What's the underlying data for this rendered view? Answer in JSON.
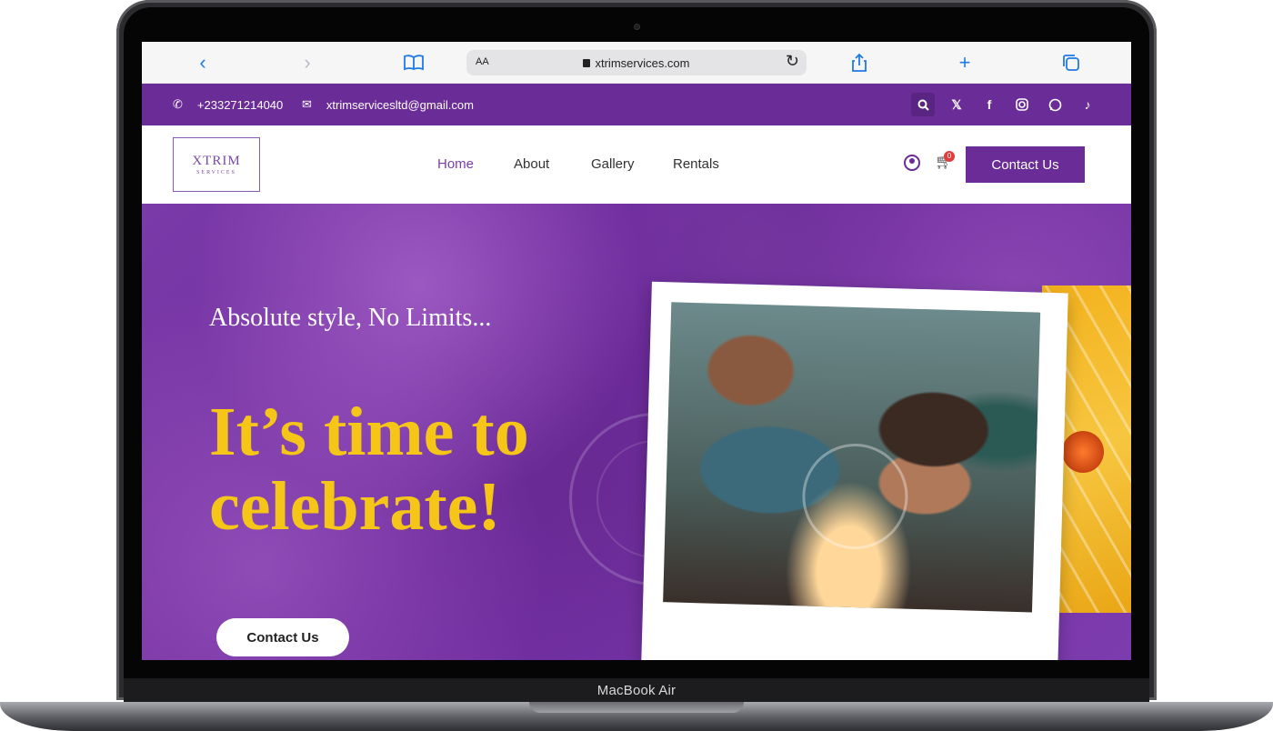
{
  "device": {
    "label": "MacBook Air"
  },
  "browser": {
    "reader_label": "AA",
    "url": "xtrimservices.com"
  },
  "topbar": {
    "phone": "+233271214040",
    "email": "xtrimservicesltd@gmail.com",
    "socials": [
      "search-icon",
      "x-icon",
      "facebook-icon",
      "instagram-icon",
      "whatsapp-icon",
      "tiktok-icon"
    ]
  },
  "nav": {
    "logo_text": "XTRIM",
    "logo_sub": "SERVICES",
    "links": [
      "Home",
      "About",
      "Gallery",
      "Rentals"
    ],
    "active": "Home",
    "cart_count": "0",
    "cta": "Contact Us"
  },
  "hero": {
    "tagline": "Absolute style, No Limits...",
    "headline": "It’s time to celebrate!",
    "cta": "Contact Us"
  },
  "colors": {
    "brand_purple": "#6a2c97",
    "headline_yellow": "#f5c518"
  }
}
